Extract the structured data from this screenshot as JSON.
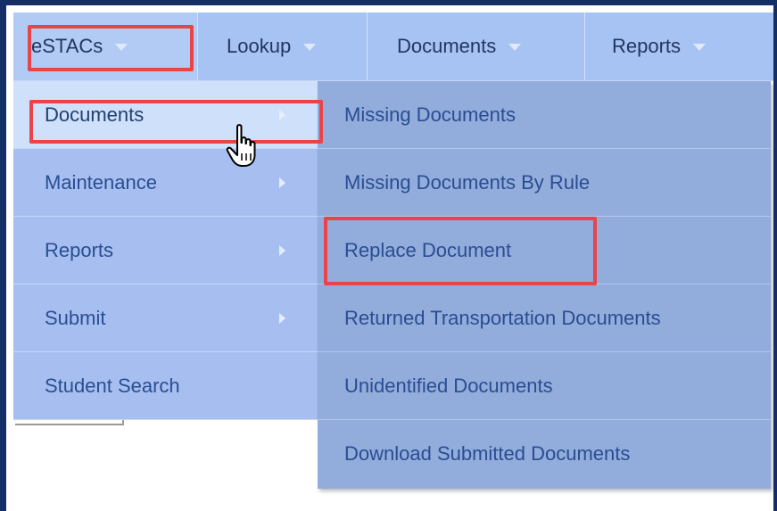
{
  "menubar": {
    "items": [
      {
        "label": "eSTACs",
        "icon": "caret-down-icon"
      },
      {
        "label": "Lookup",
        "icon": "caret-down-icon"
      },
      {
        "label": "Documents",
        "icon": "caret-down-icon"
      },
      {
        "label": "Reports",
        "icon": "caret-down-icon"
      }
    ]
  },
  "estacs_menu": {
    "items": [
      {
        "label": "Documents",
        "has_submenu": true,
        "state": "hovered"
      },
      {
        "label": "Maintenance",
        "has_submenu": true
      },
      {
        "label": "Reports",
        "has_submenu": true
      },
      {
        "label": "Submit",
        "has_submenu": true
      },
      {
        "label": "Student Search",
        "has_submenu": false
      }
    ]
  },
  "documents_submenu": {
    "items": [
      {
        "label": "Missing Documents"
      },
      {
        "label": "Missing Documents By Rule"
      },
      {
        "label": "Replace Document"
      },
      {
        "label": "Returned Transportation Documents"
      },
      {
        "label": "Unidentified Documents"
      },
      {
        "label": "Download Submitted Documents"
      }
    ]
  },
  "annotations": {
    "highlight_color": "#e8444a",
    "highlighted": [
      "eSTACs",
      "Documents",
      "Replace Document"
    ]
  },
  "colors": {
    "menubar_bg": "#a7c3f3",
    "dropdown_bg": "#a7bff0",
    "submenu_bg": "#92acdc",
    "text": "#2a4d92",
    "frame": "#142f66"
  },
  "cursor": {
    "icon": "hand-pointer-icon"
  }
}
